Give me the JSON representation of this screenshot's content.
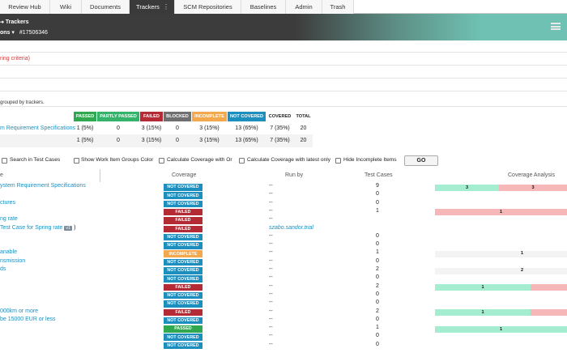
{
  "colors": {
    "passed": "#2fa84f",
    "partly": "#35b36b",
    "failed": "#b52b35",
    "blocked": "#6f6f6f",
    "incomplete": "#f2a94e",
    "not_covered": "#1d8fbf",
    "cov_green": "#a5edd0",
    "cov_red": "#f6b7b9"
  },
  "tabs": [
    {
      "label": "Review Hub"
    },
    {
      "label": "Wiki"
    },
    {
      "label": "Documents"
    },
    {
      "label": "Trackers"
    },
    {
      "label": "SCM Repositories"
    },
    {
      "label": "Baselines"
    },
    {
      "label": "Admin"
    },
    {
      "label": "Trash"
    }
  ],
  "header": {
    "breadcrumb": "Trackers",
    "title_fragment": "ons",
    "item_id": "#17506346",
    "menu_icon": "list-menu-icon"
  },
  "criteria_text": "ring criteria)",
  "grouped_text": "grouped by trackers.",
  "summary": {
    "headers": [
      "PASSED",
      "PARTLY PASSED",
      "FAILED",
      "BLOCKED",
      "INCOMPLETE",
      "NOT COVERED",
      "COVERED",
      "TOTAL"
    ],
    "rows": [
      {
        "label": "m Requirement Specifications",
        "values": [
          "1 (5%)",
          "0",
          "3 (15%)",
          "0",
          "3 (15%)",
          "13 (65%)",
          "7 (35%)",
          "20"
        ]
      },
      {
        "label": "",
        "values": [
          "1 (5%)",
          "0",
          "3 (15%)",
          "0",
          "3 (15%)",
          "13 (65%)",
          "7 (35%)",
          "20"
        ]
      }
    ]
  },
  "filters": {
    "search_tc": "Search in Test Cases",
    "groups_color": "Show Work Item Groups Color",
    "cov_or": "Calculate Coverage with Or",
    "cov_latest": "Calculate Coverage with latest only",
    "hide_incomplete": "Hide Incomplete Items",
    "go": "GO"
  },
  "columns": {
    "name": "e",
    "coverage": "Coverage",
    "runby": "Run by",
    "testcases": "Test Cases",
    "analysis": "Coverage Analysis"
  },
  "rows": [
    {
      "name": "ystem Requirement Specifications",
      "status": "NOT COVERED",
      "runby": "--",
      "tc": "9",
      "analysis": "gr"
    },
    {
      "name": "",
      "status": "NOT COVERED",
      "runby": "--",
      "tc": "0",
      "analysis": ""
    },
    {
      "name": "ctures",
      "status": "NOT COVERED",
      "runby": "--",
      "tc": "0",
      "analysis": ""
    },
    {
      "name": "",
      "status": "FAILED",
      "runby": "--",
      "tc": "1",
      "analysis": "r"
    },
    {
      "name": "ng rate",
      "status": "FAILED",
      "runby": "--",
      "tc": "",
      "analysis": ""
    },
    {
      "name": "Test Case for Spring rate",
      "version": "v1",
      "tail": ")",
      "status": "FAILED",
      "runby": "szabo.sandor.trial",
      "tc": "",
      "analysis": ""
    },
    {
      "name": "",
      "status": "NOT COVERED",
      "runby": "--",
      "tc": "0",
      "analysis": ""
    },
    {
      "name": "",
      "status": "NOT COVERED",
      "runby": "--",
      "tc": "0",
      "analysis": ""
    },
    {
      "name": "anable",
      "status": "INCOMPLETE",
      "runby": "--",
      "tc": "1",
      "analysis": "p1"
    },
    {
      "name": "nsmission",
      "status": "NOT COVERED",
      "runby": "--",
      "tc": "0",
      "analysis": ""
    },
    {
      "name": "ds",
      "status": "NOT COVERED",
      "runby": "--",
      "tc": "2",
      "analysis": "p2"
    },
    {
      "name": "",
      "status": "NOT COVERED",
      "runby": "--",
      "tc": "0",
      "analysis": ""
    },
    {
      "name": "",
      "status": "FAILED",
      "runby": "--",
      "tc": "2",
      "analysis": "gp"
    },
    {
      "name": "",
      "status": "NOT COVERED",
      "runby": "--",
      "tc": "0",
      "analysis": ""
    },
    {
      "name": "",
      "status": "NOT COVERED",
      "runby": "--",
      "tc": "0",
      "analysis": ""
    },
    {
      "name": "000km or more",
      "status": "FAILED",
      "runby": "--",
      "tc": "2",
      "analysis": "gp"
    },
    {
      "name": "be 15000 EUR or less",
      "status": "NOT COVERED",
      "runby": "--",
      "tc": "0",
      "analysis": ""
    },
    {
      "name": "",
      "status": "PASSED",
      "runby": "--",
      "tc": "1",
      "analysis": "g"
    },
    {
      "name": "",
      "status": "NOT COVERED",
      "runby": "--",
      "tc": "0",
      "analysis": ""
    },
    {
      "name": "",
      "status": "NOT COVERED",
      "runby": "--",
      "tc": "0",
      "analysis": ""
    }
  ],
  "analysis_labels": {
    "a3": "3",
    "b3": "3",
    "one": "1",
    "two": "2"
  }
}
